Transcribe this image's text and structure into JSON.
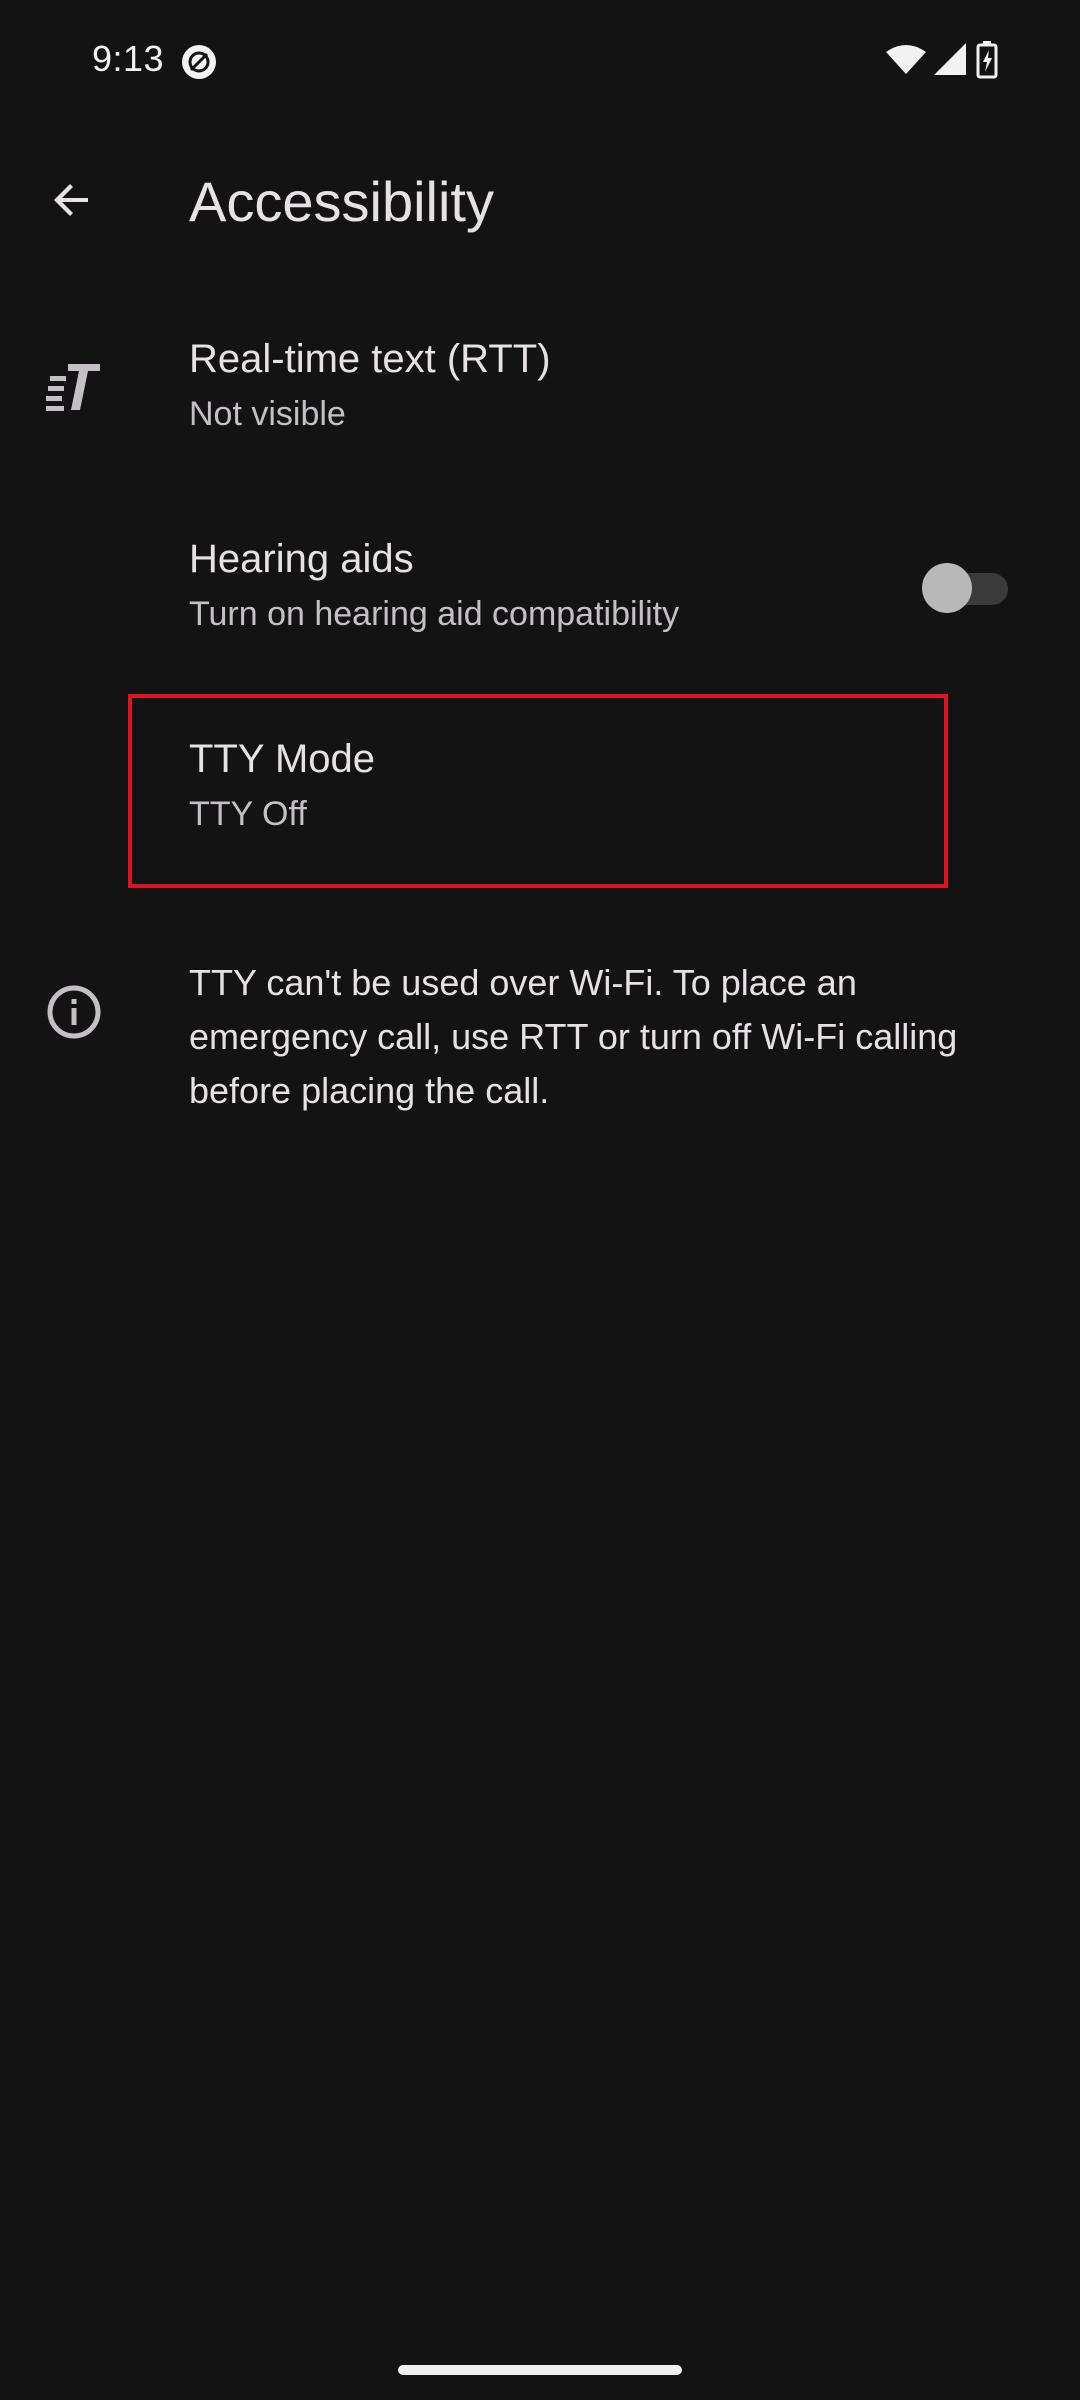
{
  "status_bar": {
    "time": "9:13",
    "left_icon": "vpn-disc-icon",
    "right_icons": [
      "wifi-icon",
      "cell-signal-icon",
      "battery-charging-icon"
    ]
  },
  "app_bar": {
    "back_icon": "arrow-back-icon",
    "title": "Accessibility"
  },
  "preferences": [
    {
      "key": "rtt",
      "icon": "rtt-text-icon",
      "title": "Real-time text (RTT)",
      "summary": "Not visible"
    },
    {
      "key": "hearing_aids",
      "icon": "",
      "title": "Hearing aids",
      "summary": "Turn on hearing aid compatibility",
      "toggle_on": false
    },
    {
      "key": "tty_mode",
      "icon": "",
      "title": "TTY Mode",
      "summary": "TTY Off",
      "highlighted": true
    }
  ],
  "footer": {
    "icon": "info-icon",
    "text": "TTY can't be used over Wi-Fi. To place an emergency call, use RTT or turn off Wi-Fi calling before placing the call."
  },
  "colors": {
    "background": "#131313",
    "highlight": "#e0141e",
    "primary_text": "#e6e1e5",
    "secondary_text": "#c4c0c5"
  }
}
